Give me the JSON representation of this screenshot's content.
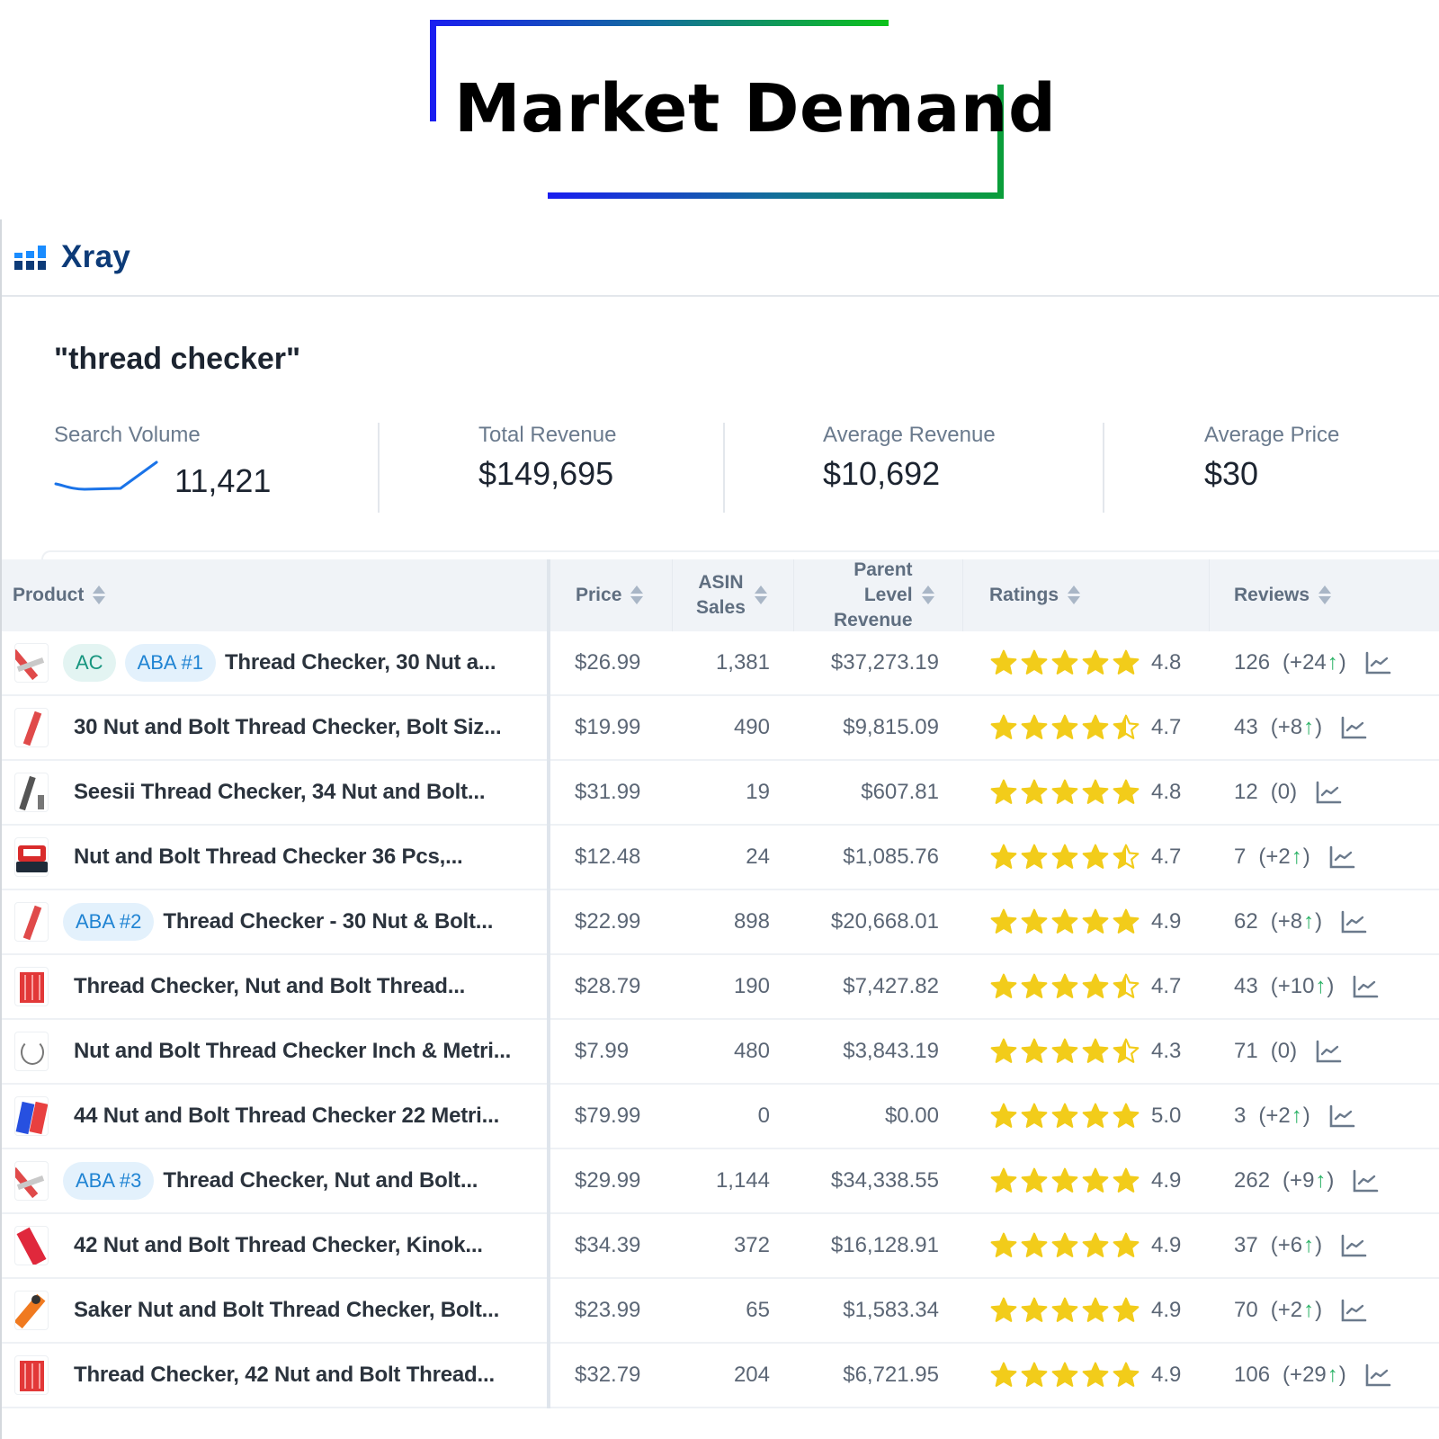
{
  "banner": {
    "title": "Market Demand"
  },
  "app": {
    "name": "Xray",
    "logo_icon": "bar-chart-icon"
  },
  "search": {
    "keyword": "\"thread checker\""
  },
  "metrics": [
    {
      "label": "Search Volume",
      "value": "11,421",
      "has_sparkline": true
    },
    {
      "label": "Total Revenue",
      "value": "$149,695"
    },
    {
      "label": "Average Revenue",
      "value": "$10,692"
    },
    {
      "label": "Average Price",
      "value": "$30"
    }
  ],
  "colors": {
    "brand_navy": "#0d3b78",
    "brand_blue": "#1a8cff",
    "star_yellow": "#f2cc1a",
    "up_green": "#2bb266",
    "ac_badge_text": "#17957f",
    "aba_badge_text": "#2084d3",
    "sparkline": "#1a73e8"
  },
  "table": {
    "columns": [
      {
        "key": "product",
        "label": "Product"
      },
      {
        "key": "price",
        "label": "Price"
      },
      {
        "key": "asin_sales",
        "label": "ASIN Sales"
      },
      {
        "key": "parent_revenue",
        "label": "Parent Level Revenue"
      },
      {
        "key": "ratings",
        "label": "Ratings"
      },
      {
        "key": "reviews",
        "label": "Reviews"
      }
    ],
    "header": {
      "product": "Product",
      "price": "Price",
      "asin_sales_1": "ASIN",
      "asin_sales_2": "Sales",
      "parent_1": "Parent",
      "parent_2": "Level",
      "parent_3": "Revenue",
      "ratings": "Ratings",
      "reviews": "Reviews"
    },
    "rows": [
      {
        "badges": [
          "AC",
          "ABA #1"
        ],
        "name": "Thread Checker, 30 Nut a...",
        "price": "$26.99",
        "sales": "1,381",
        "revenue": "$37,273.19",
        "rating": "4.8",
        "stars": 5,
        "reviews": "126",
        "delta": "+24",
        "trend": "up",
        "thumb": "red-cross"
      },
      {
        "badges": [],
        "name": "30 Nut and Bolt Thread Checker, Bolt Siz...",
        "price": "$19.99",
        "sales": "490",
        "revenue": "$9,815.09",
        "rating": "4.7",
        "stars": 4.5,
        "reviews": "43",
        "delta": "+8",
        "trend": "up",
        "thumb": "red-bar"
      },
      {
        "badges": [],
        "name": "Seesii Thread Checker, 34 Nut and Bolt...",
        "price": "$31.99",
        "sales": "19",
        "revenue": "$607.81",
        "rating": "4.8",
        "stars": 5,
        "reviews": "12",
        "delta": "0",
        "trend": "none",
        "thumb": "gray-bar"
      },
      {
        "badges": [],
        "name": "Nut and Bolt Thread Checker 36 Pcs,...",
        "price": "$12.48",
        "sales": "24",
        "revenue": "$1,085.76",
        "rating": "4.7",
        "stars": 4.5,
        "reviews": "7",
        "delta": "+2",
        "trend": "up",
        "thumb": "case"
      },
      {
        "badges": [
          "ABA #2"
        ],
        "name": "Thread Checker - 30 Nut & Bolt...",
        "price": "$22.99",
        "sales": "898",
        "revenue": "$20,668.01",
        "rating": "4.9",
        "stars": 5,
        "reviews": "62",
        "delta": "+8",
        "trend": "up",
        "thumb": "red-bar"
      },
      {
        "badges": [],
        "name": "Thread Checker, Nut and Bolt Thread...",
        "price": "$28.79",
        "sales": "190",
        "revenue": "$7,427.82",
        "rating": "4.7",
        "stars": 4.5,
        "reviews": "43",
        "delta": "+10",
        "trend": "up",
        "thumb": "red-block"
      },
      {
        "badges": [],
        "name": "Nut and Bolt Thread Checker Inch & Metri...",
        "price": "$7.99",
        "sales": "480",
        "revenue": "$3,843.19",
        "rating": "4.3",
        "stars": 4.5,
        "reviews": "71",
        "delta": "0",
        "trend": "none",
        "thumb": "ring"
      },
      {
        "badges": [],
        "name": "44 Nut and Bolt Thread Checker 22 Metri...",
        "price": "$79.99",
        "sales": "0",
        "revenue": "$0.00",
        "rating": "5.0",
        "stars": 5,
        "reviews": "3",
        "delta": "+2",
        "trend": "up",
        "thumb": "blue-red"
      },
      {
        "badges": [
          "ABA #3"
        ],
        "name": "Thread Checker, Nut and Bolt...",
        "price": "$29.99",
        "sales": "1,144",
        "revenue": "$34,338.55",
        "rating": "4.9",
        "stars": 5,
        "reviews": "262",
        "delta": "+9",
        "trend": "up",
        "thumb": "red-cross"
      },
      {
        "badges": [],
        "name": "42 Nut and Bolt Thread Checker, Kinok...",
        "price": "$34.39",
        "sales": "372",
        "revenue": "$16,128.91",
        "rating": "4.9",
        "stars": 5,
        "reviews": "37",
        "delta": "+6",
        "trend": "up",
        "thumb": "red-tilt"
      },
      {
        "badges": [],
        "name": "Saker Nut and Bolt Thread Checker, Bolt...",
        "price": "$23.99",
        "sales": "65",
        "revenue": "$1,583.34",
        "rating": "4.9",
        "stars": 5,
        "reviews": "70",
        "delta": "+2",
        "trend": "up",
        "thumb": "orange"
      },
      {
        "badges": [],
        "name": "Thread Checker, 42 Nut and Bolt Thread...",
        "price": "$32.79",
        "sales": "204",
        "revenue": "$6,721.95",
        "rating": "4.9",
        "stars": 5,
        "reviews": "106",
        "delta": "+29",
        "trend": "up",
        "thumb": "red-block"
      }
    ]
  }
}
